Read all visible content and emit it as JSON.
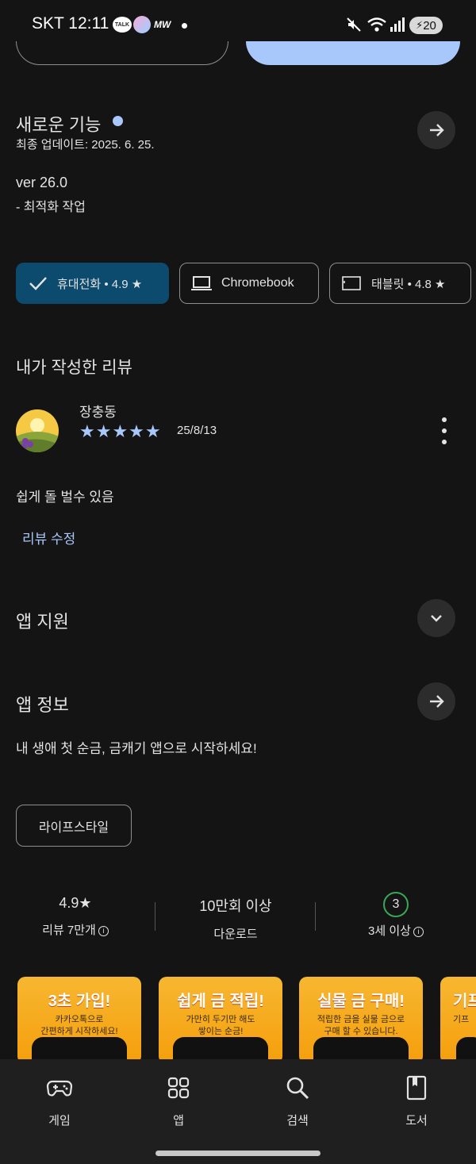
{
  "status_bar": {
    "carrier_time": "SKT 12:11",
    "talk": "TALK",
    "mw": "MW",
    "battery": "20"
  },
  "whats_new": {
    "title": "새로운 기능",
    "updated": "최종 업데이트: 2025. 6. 25.",
    "version": "ver 26.0",
    "note": "- 최적화 작업"
  },
  "device_chips": [
    {
      "label": "휴대전화 • 4.9 ★",
      "selected": true
    },
    {
      "label": "Chromebook",
      "selected": false
    },
    {
      "label": "태블릿 • 4.8 ★",
      "selected": false
    }
  ],
  "my_review": {
    "title": "내가 작성한 리뷰",
    "reviewer": "장충동",
    "stars": "★★★★★",
    "rating": 5,
    "date": "25/8/13",
    "text": "쉽게 돌 벌수 있음",
    "edit_label": "리뷰 수정"
  },
  "app_support": {
    "title": "앱 지원"
  },
  "app_info": {
    "title": "앱 정보",
    "description": "내 생애 첫 순금, 금캐기 앱으로 시작하세요!",
    "category": "라이프스타일"
  },
  "stats": {
    "rating": "4.9★",
    "reviews": "리뷰 7만개",
    "downloads": "10만회 이상",
    "downloads_label": "다운로드",
    "age": "3",
    "age_label": "3세 이상"
  },
  "screenshots": [
    {
      "headline": "3초 가입!",
      "sub1": "카카오톡으로",
      "sub2": "간편하게 시작하세요!"
    },
    {
      "headline": "쉽게 금 적립!",
      "sub1": "가만히 두기만 해도",
      "sub2": "쌓이는 순금!"
    },
    {
      "headline": "실물 금 구매!",
      "sub1": "적립한 금을 실물 금으로",
      "sub2": "구매 할 수 있습니다."
    },
    {
      "headline": "기프",
      "sub1": "기프",
      "sub2": ""
    }
  ],
  "bottom_nav": [
    {
      "label": "게임",
      "icon": "gamepad-icon"
    },
    {
      "label": "앱",
      "icon": "apps-grid-icon"
    },
    {
      "label": "검색",
      "icon": "search-icon"
    },
    {
      "label": "도서",
      "icon": "book-icon"
    }
  ],
  "colors": {
    "accent": "#a8c7fa",
    "selected_chip": "#0c4a6e",
    "background": "#141414",
    "age_ring": "#3aa757"
  }
}
